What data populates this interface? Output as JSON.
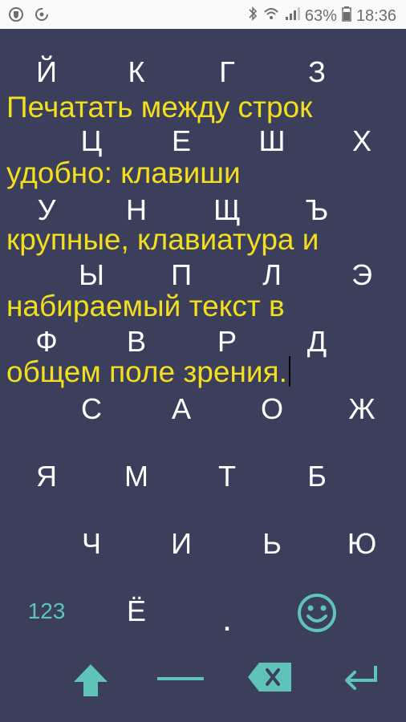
{
  "status_bar": {
    "battery_percent": "63%",
    "time": "18:36"
  },
  "keys": {
    "row1": [
      "Й",
      "К",
      "Г",
      "З"
    ],
    "row2": [
      "Ц",
      "Е",
      "Ш",
      "Х"
    ],
    "row3": [
      "У",
      "Н",
      "Щ",
      "Ъ"
    ],
    "row4": [
      "Ы",
      "П",
      "Л",
      "Э"
    ],
    "row5": [
      "Ф",
      "В",
      "Р",
      "Д"
    ],
    "row6": [
      "С",
      "А",
      "О",
      "Ж"
    ],
    "row7": [
      "Я",
      "М",
      "Т",
      "Б"
    ],
    "row8": [
      "Ч",
      "И",
      "Ь",
      "Ю"
    ]
  },
  "typed_text": {
    "lines": [
      "Печатать между строк",
      "удобно: клавиши",
      "крупные, клавиатура и",
      "набираемый текст в",
      "общем поле зрения."
    ]
  },
  "function_row": {
    "numbers_label": "123",
    "yo_key": "Ё",
    "period_key": "."
  },
  "colors": {
    "background": "#3c3f5c",
    "key_text": "#ffffff",
    "typed_text": "#f3df1e",
    "accent": "#5fc3ba"
  },
  "icons": {
    "shift": "shift-up-arrow-icon",
    "space": "space-bar-icon",
    "backspace": "backspace-icon",
    "enter": "enter-return-icon",
    "emoji": "smiley-emoji-icon"
  }
}
